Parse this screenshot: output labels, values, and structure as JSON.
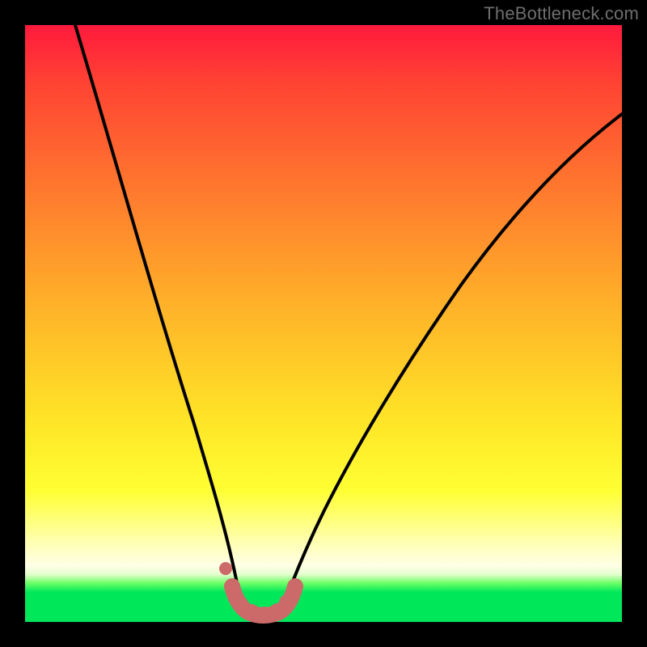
{
  "watermark": "TheBottleneck.com",
  "colors": {
    "background": "#000000",
    "gradient_top": "#ff1a3c",
    "gradient_mid": "#ffe427",
    "gradient_light_band": "#ffffe6",
    "gradient_bottom": "#00e85a",
    "curve": "#000000",
    "marker": "#cc6a6a"
  },
  "chart_data": {
    "type": "line",
    "title": "",
    "xlabel": "",
    "ylabel": "",
    "xlim": [
      0,
      100
    ],
    "ylim": [
      0,
      100
    ],
    "grid": false,
    "legend": null,
    "series": [
      {
        "name": "left-branch",
        "x": [
          8,
          12,
          16,
          20,
          24,
          28,
          30,
          32,
          34,
          35
        ],
        "y": [
          100,
          81,
          64,
          48,
          34,
          21,
          15,
          10,
          6,
          3
        ]
      },
      {
        "name": "right-branch",
        "x": [
          42,
          46,
          52,
          58,
          66,
          74,
          82,
          90,
          98,
          100
        ],
        "y": [
          3,
          10,
          22,
          33,
          45,
          56,
          66,
          75,
          83,
          85
        ]
      },
      {
        "name": "bottom-markers",
        "x": [
          32,
          33.5,
          35,
          36.5,
          38,
          39.5,
          41,
          42.5,
          44
        ],
        "y": [
          5,
          2.5,
          1.2,
          0.8,
          0.8,
          0.8,
          1.2,
          2.5,
          5
        ]
      }
    ],
    "annotations": [
      {
        "text": "TheBottleneck.com",
        "position": "top-right"
      }
    ]
  }
}
